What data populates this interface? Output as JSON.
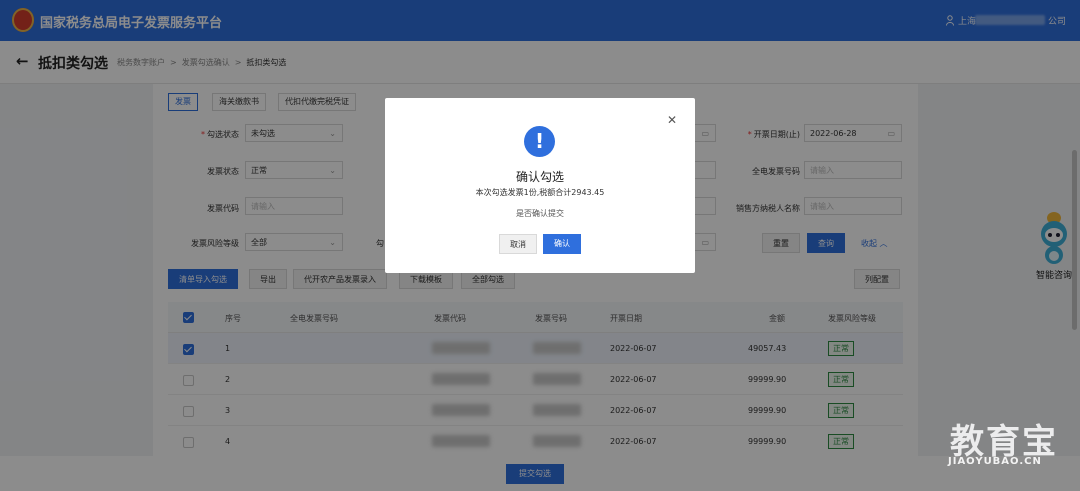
{
  "app": {
    "title": "国家税务总局电子发票服务平台",
    "user_prefix": "上海",
    "user_suffix": "公司"
  },
  "header": {
    "title": "抵扣类勾选",
    "breadcrumbs": [
      "税务数字账户",
      "发票勾选确认",
      "抵扣类勾选"
    ]
  },
  "tabs": [
    "发票",
    "海关缴款书",
    "代扣代缴完税凭证"
  ],
  "filters": {
    "select_status": {
      "label": "勾选状态",
      "value": "未勾选",
      "required": true
    },
    "invoice_status": {
      "label": "发票状态",
      "value": "正常"
    },
    "invoice_code": {
      "label": "发票代码",
      "placeholder": "请输入"
    },
    "risk_level": {
      "label": "发票风险等级",
      "value": "全部"
    },
    "risk_level_next_label_fragment": "勾",
    "issue_date_end": {
      "label": "开票日期(止)",
      "value": "2022-06-28",
      "required": true
    },
    "full_invoice_no": {
      "label": "全电发票号码",
      "placeholder": "请输入"
    },
    "seller_name": {
      "label": "销售方纳税人名称",
      "placeholder": "请输入"
    }
  },
  "actions": {
    "reset": "重置",
    "query": "查询",
    "collapse": "收起",
    "list_import": "清单导入勾选",
    "export": "导出",
    "agri_entry": "代开农产品发票录入",
    "download_template": "下载模板",
    "select_all": "全部勾选",
    "column_config": "列配置",
    "submit": "提交勾选"
  },
  "table": {
    "columns": [
      "序号",
      "全电发票号码",
      "发票代码",
      "发票号码",
      "开票日期",
      "金额",
      "发票风险等级"
    ],
    "rows": [
      {
        "index": "1",
        "date": "2022-06-07",
        "amount": "49057.43",
        "risk": "正常",
        "checked": true
      },
      {
        "index": "2",
        "date": "2022-06-07",
        "amount": "99999.90",
        "risk": "正常",
        "checked": false
      },
      {
        "index": "3",
        "date": "2022-06-07",
        "amount": "99999.90",
        "risk": "正常",
        "checked": false
      },
      {
        "index": "4",
        "date": "2022-06-07",
        "amount": "99999.90",
        "risk": "正常",
        "checked": false
      }
    ]
  },
  "assistant": {
    "label": "智能咨询"
  },
  "watermark": {
    "main": "教育宝",
    "sub": "JIAOYUBAO.CN"
  },
  "dialog": {
    "title": "确认勾选",
    "message": "本次勾选发票1份,税额合计2943.45",
    "question": "是否确认提交",
    "cancel": "取消",
    "confirm": "确认"
  },
  "colors": {
    "primary": "#2f6fdd",
    "success": "#2e8b43"
  },
  "icons": [
    "back-arrow-icon",
    "user-icon",
    "calendar-icon",
    "chevron-down-icon",
    "chevron-up-icon",
    "close-icon",
    "warning-icon",
    "robot-icon"
  ]
}
